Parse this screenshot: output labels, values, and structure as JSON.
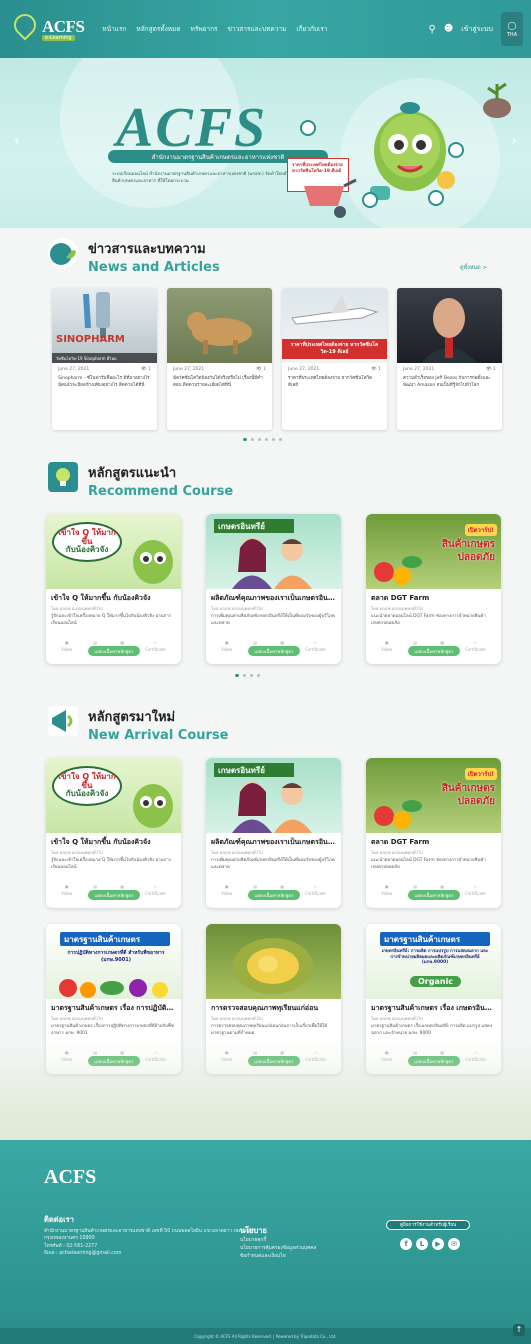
{
  "nav": {
    "logo": "ACFS",
    "logo_sub": "e-Learning",
    "menu": [
      "หน้าแรก",
      "หลักสูตรทั้งหมด",
      "ทรัพยากร",
      "ข่าวสารและบทความ",
      "เกี่ยวกับเรา"
    ],
    "login": "เข้าสู่ระบบ",
    "lang": "THA"
  },
  "hero": {
    "title": "ACFS",
    "band": "สำนักงานมาตรฐานสินค้าเกษตรและอาหารแห่งชาติ",
    "desc": "ระบบเรียนออนไลน์ สำนักงานมาตรฐานสินค้าเกษตรและอาหารแห่งชาติ (มกอช.) จัดทำโดยสำนักงานมาตรฐานสินค้าเกษตรและอาหาร ที่ให้โดยกระบวน",
    "poster": "ราคาที่ประเทศไทยต้องจ่าย หากวัคซีนโควิด-19 ดีเลย์"
  },
  "news": {
    "title_th": "ข่าวสารและบทความ",
    "title_en": "News and Articles",
    "more": "ดูทั้งหมด >",
    "items": [
      {
        "date": "June 27, 2021",
        "views": "1",
        "text": "Sinopharm - ซีโนฟาร์มคืออะไร มีที่มาอย่างไร ฉีดแล้วจะมีผลข้างเคียงอย่างไร ติดตามได้ที่นี่",
        "img_label": "SINOPHARM",
        "img_sub": "วัคซีนโควิด-19 Sinopharm ดีไหม"
      },
      {
        "date": "June 27, 2021",
        "views": "1",
        "text": "ฉีดวัคซีนโควิดป้องกันได้จริงหรือไม่ เรื่องนี้มีคำตอบ ติดตามรายละเอียดได้ที่นี่",
        "img_label": "",
        "img_sub": ""
      },
      {
        "date": "June 27, 2021",
        "views": "1",
        "text": "ราคาที่ประเทศไทยต้องจ่าย หากวัคซีนโควิดดีเลย์",
        "img_label": "ราคาที่ประเทศไทยต้องจ่าย หากวัคซีนโควิด-19 ดีเลย์",
        "img_sub": ""
      },
      {
        "date": "June 27, 2021",
        "views": "1",
        "text": "ความสำเร็จของ Jeff Bezos กับการก่อตั้งและพัฒนา Amazon จนเป็นที่รู้จักไปทั่วโลก",
        "img_label": "",
        "img_sub": ""
      }
    ]
  },
  "recommend": {
    "title_th": "หลักสูตรแนะนำ",
    "title_en": "Recommend Course",
    "items": [
      {
        "title": "เข้าใจ Q ให้มากขึ้น กับน้องคิวจัง",
        "by": "โดย มกอช.อบรมบุคคลทั่วไป",
        "desc": "รู้จักและเข้าใจเครื่องหมาย Q ให้มากขึ้นไปกับน้องคิวจัง ผ่านการเรียนออนไลน์",
        "bubble1": "เข้าใจ Q ให้มากขึ้น",
        "bubble2": "กับน้องคิวจัง"
      },
      {
        "title": "ผลิตภัณฑ์คุณภาพของเราเป็นเกษตรอินทรีย์",
        "by": "โดย มกอช.อบรมบุคคลทั่วไป",
        "desc": "การเพิ่มคุณค่าผลิตภัณฑ์เกษตรอินทรีย์ให้เป็นที่ยอมรับของผู้บริโภคและตลาด",
        "banner": "เกษตรอินทรีย์"
      },
      {
        "title": "ตลาด DGT Farm",
        "by": "โดย มกอช.อบรมบุคคลทั่วไป",
        "desc": "แนะนำตลาดออนไลน์ DGT Farm ช่องทางการจำหน่ายสินค้าเกษตรปลอดภัย",
        "banner": "สินค้าเกษตรปลอดภัย",
        "tag": "เปิดวาร์ป!"
      }
    ],
    "icons": [
      "Video",
      "Files",
      "Quiz",
      "Certificate"
    ],
    "button": "แสดงเนื้อหาหลักสูตร"
  },
  "arrival": {
    "title_th": "หลักสูตรมาใหม่",
    "title_en": "New Arrival Course",
    "items": [
      {
        "title": "เข้าใจ Q ให้มากขึ้น กับน้องคิวจัง",
        "by": "โดย มกอช.อบรมบุคคลทั่วไป",
        "desc": "รู้จักและเข้าใจเครื่องหมาย Q ให้มากขึ้นไปกับน้องคิวจัง ผ่านการเรียนออนไลน์",
        "bubble1": "เข้าใจ Q ให้มากขึ้น",
        "bubble2": "กับน้องคิวจัง"
      },
      {
        "title": "ผลิตภัณฑ์คุณภาพของเราเป็นเกษตรอินทรีย์",
        "by": "โดย มกอช.อบรมบุคคลทั่วไป",
        "desc": "การเพิ่มคุณค่าผลิตภัณฑ์เกษตรอินทรีย์ให้เป็นที่ยอมรับของผู้บริโภคและตลาด",
        "banner": "เกษตรอินทรีย์"
      },
      {
        "title": "ตลาด DGT Farm",
        "by": "โดย มกอช.อบรมบุคคลทั่วไป",
        "desc": "แนะนำตลาดออนไลน์ DGT Farm ช่องทางการจำหน่ายสินค้าเกษตรปลอดภัย",
        "banner": "สินค้าเกษตรปลอดภัย",
        "tag": "เปิดวาร์ป!"
      },
      {
        "title": "มาตรฐานสินค้าเกษตร เรื่อง การปฏิบัติทางการเกษตรที่ดีสำหรับพืชอาหาร",
        "by": "โดย มกอช.อบรมบุคคลทั่วไป",
        "desc": "มาตรฐานสินค้าเกษตร เรื่องการปฏิบัติทางการเกษตรที่ดีสำหรับพืชอาหาร มกษ. 9001",
        "banner": "มาตรฐานสินค้าเกษตร",
        "banner2": "การปฏิบัติทางการเกษตรที่ดี สำหรับพืชอาหาร (มกษ.9001)"
      },
      {
        "title": "การตรวจสอบคุณภาพทุเรียนแก่อ่อน",
        "by": "โดย มกอช.อบรมบุคคลทั่วไป",
        "desc": "การตรวจสอบคุณภาพทุเรียนแก่อ่อนก่อนการเก็บเกี่ยวเพื่อให้ได้มาตรฐานตามที่กำหนด",
        "banner": ""
      },
      {
        "title": "มาตรฐานสินค้าเกษตร เรื่อง เกษตรอินทรีย์",
        "by": "โดย มกอช.อบรมบุคคลทั่วไป",
        "desc": "มาตรฐานสินค้าเกษตร เรื่องเกษตรอินทรีย์ การผลิต แปรรูป แสดงฉลาก และจำหน่าย มกษ. 9000",
        "banner": "มาตรฐานสินค้าเกษตร",
        "banner2": "เกษตรอินทรีย์: การผลิต การแปรรูป การแสดงฉลาก และการจำหน่ายผลิตผลและผลิตภัณฑ์เกษตรอินทรีย์ (มกษ.9000)",
        "tag": "Organic"
      }
    ]
  },
  "footer": {
    "logo": "ACFS",
    "contact_title": "ติดต่อเรา",
    "address": "สำนักงานมาตรฐานสินค้าเกษตรและอาหารแห่งชาติ เลขที่ 50 ถนนพหลโยธิน แขวงลาดยาว เขตจตุจักร กรุงเทพมหานคร 10900",
    "phone": "โทรศัพท์ : 02-561-2277",
    "email": "อีเมล : acfselearning@gmail.com",
    "policy_title": "นโยบาย",
    "policies": [
      "นโยบายคุกกี้",
      "นโยบายการคุ้มครองข้อมูลส่วนบุคคล",
      "ข้อกำหนดและเงื่อนไข"
    ],
    "manual": "คู่มือการใช้งานสำหรับผู้เรียน",
    "copyright": "Copyright © ACFS All Rights Reserved. | Powered by Tripodata Co., Ltd."
  }
}
